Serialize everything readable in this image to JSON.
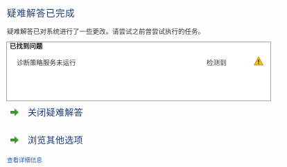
{
  "header": {
    "title": "疑难解答已完成",
    "description": "疑难解答已对系统进行了一些更改。请尝试之前曾尝试执行的任务。"
  },
  "problems": {
    "header": "已找到问题",
    "items": [
      {
        "name": "诊断策略服务未运行",
        "status": "检测到",
        "icon": "warning-icon"
      }
    ]
  },
  "actions": [
    {
      "label": "关闭疑难解答",
      "icon": "green-arrow-icon"
    },
    {
      "label": "浏览其他选项",
      "icon": "green-arrow-icon"
    }
  ],
  "footer": {
    "details_link": "查看详细信息"
  },
  "colors": {
    "title": "#1e3f7a",
    "action_text": "#1d3a7e",
    "link": "#1a5bbf",
    "arrow": "#3a9a2a",
    "warning": "#f2c21b"
  }
}
